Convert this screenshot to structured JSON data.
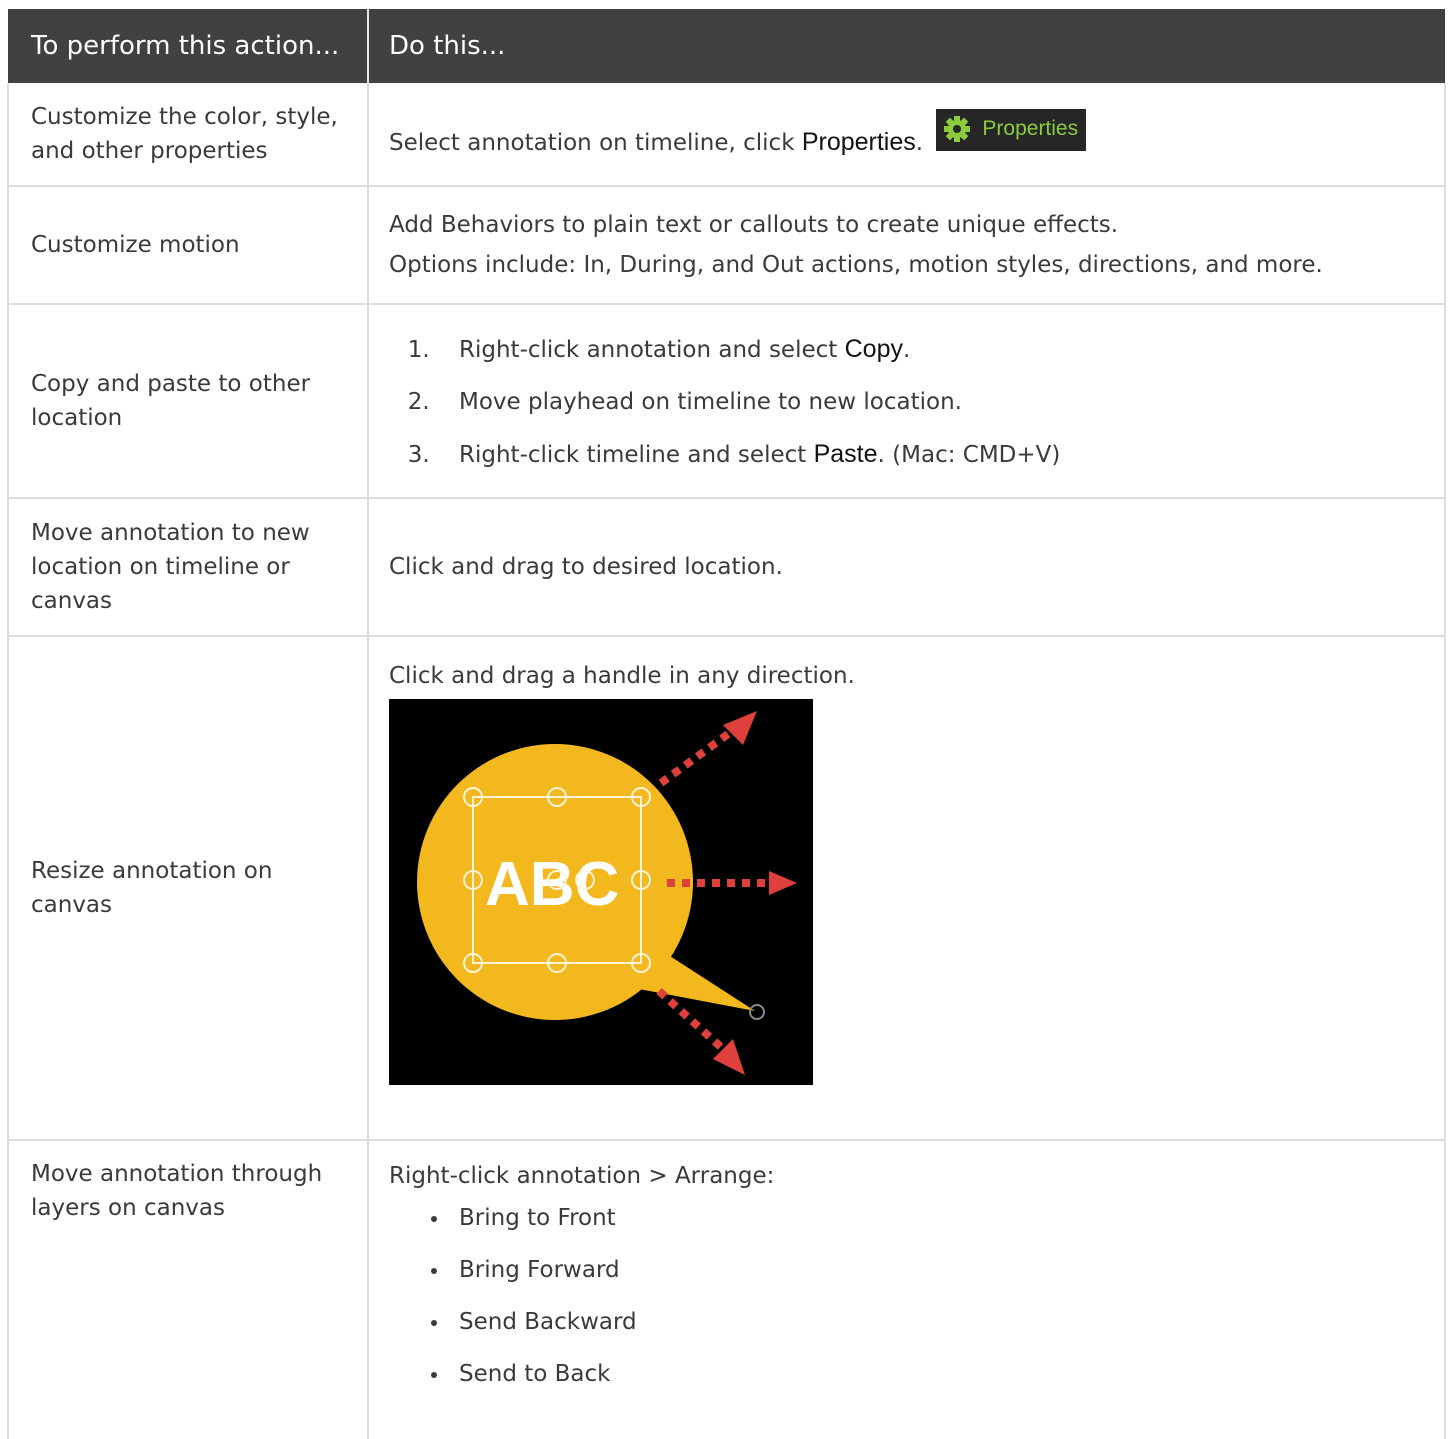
{
  "header": {
    "col1": "To perform this action...",
    "col2": "Do this..."
  },
  "rows": [
    {
      "action": "Customize the color, style, and other properties",
      "text_before": "Select annotation on timeline, click ",
      "ui_label": "Properties",
      "text_after": ".",
      "button_label": "Properties",
      "button_icon": "gear-icon"
    },
    {
      "action": "Customize motion",
      "line1": "Add Behaviors to plain text or callouts to create unique effects.",
      "line2": "Options include: In, During, and Out actions, motion styles, directions, and more."
    },
    {
      "action": "Copy and paste to other location",
      "steps": [
        {
          "before": "Right-click annotation and select ",
          "ui": "Copy",
          "after": "."
        },
        {
          "before": "Move playhead on timeline to new location.",
          "ui": "",
          "after": ""
        },
        {
          "before": "Right-click timeline and select ",
          "ui": "Paste",
          "after": ". (Mac: CMD+V)"
        }
      ]
    },
    {
      "action": "Move annotation to new location on timeline or canvas",
      "instruction": "Click and drag to desired location."
    },
    {
      "action": "Resize annotation on canvas",
      "instruction": "Click and drag a handle in any direction.",
      "image_text": "ABC",
      "image_colors": {
        "background": "#000000",
        "bubble": "#f2b81e",
        "arrow": "#e0403c"
      }
    },
    {
      "action": "Move annotation through layers on canvas",
      "intro": "Right-click annotation > Arrange:",
      "options": [
        "Bring to Front",
        "Bring Forward",
        "Send Backward",
        "Send to Back"
      ]
    }
  ]
}
